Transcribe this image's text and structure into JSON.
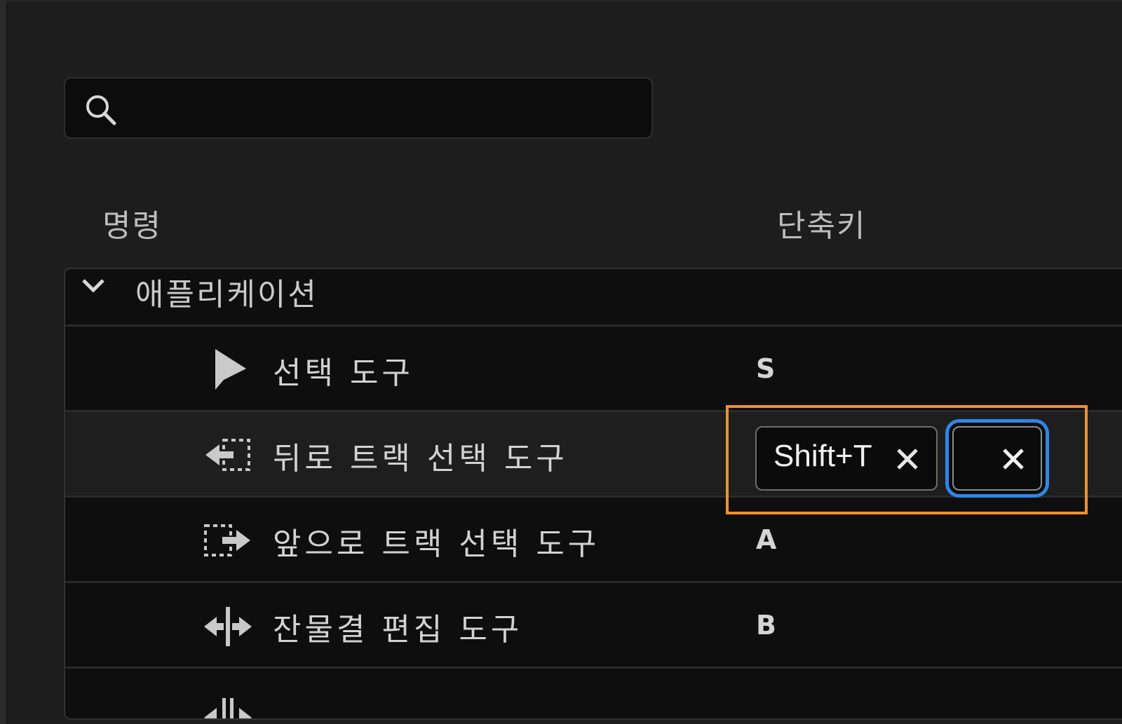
{
  "search": {
    "placeholder": "",
    "value": ""
  },
  "columns": {
    "command": "명령",
    "shortcut": "단축키"
  },
  "group": {
    "label": "애플리케이션",
    "expanded": true
  },
  "rows": [
    {
      "label": "선택 도구",
      "shortcut": "S",
      "icon": "selection-arrow-icon"
    },
    {
      "label": "뒤로 트랙 선택 도구",
      "shortcut": "Shift+T",
      "icon": "track-select-backward-icon",
      "selected": true
    },
    {
      "label": "앞으로 트랙 선택 도구",
      "shortcut": "A",
      "icon": "track-select-forward-icon"
    },
    {
      "label": "잔물결 편집 도구",
      "shortcut": "B",
      "icon": "ripple-edit-icon"
    }
  ],
  "colors": {
    "highlight": "#f0902e",
    "focus_ring": "#2e86e8",
    "background": "#1d1d1d"
  }
}
